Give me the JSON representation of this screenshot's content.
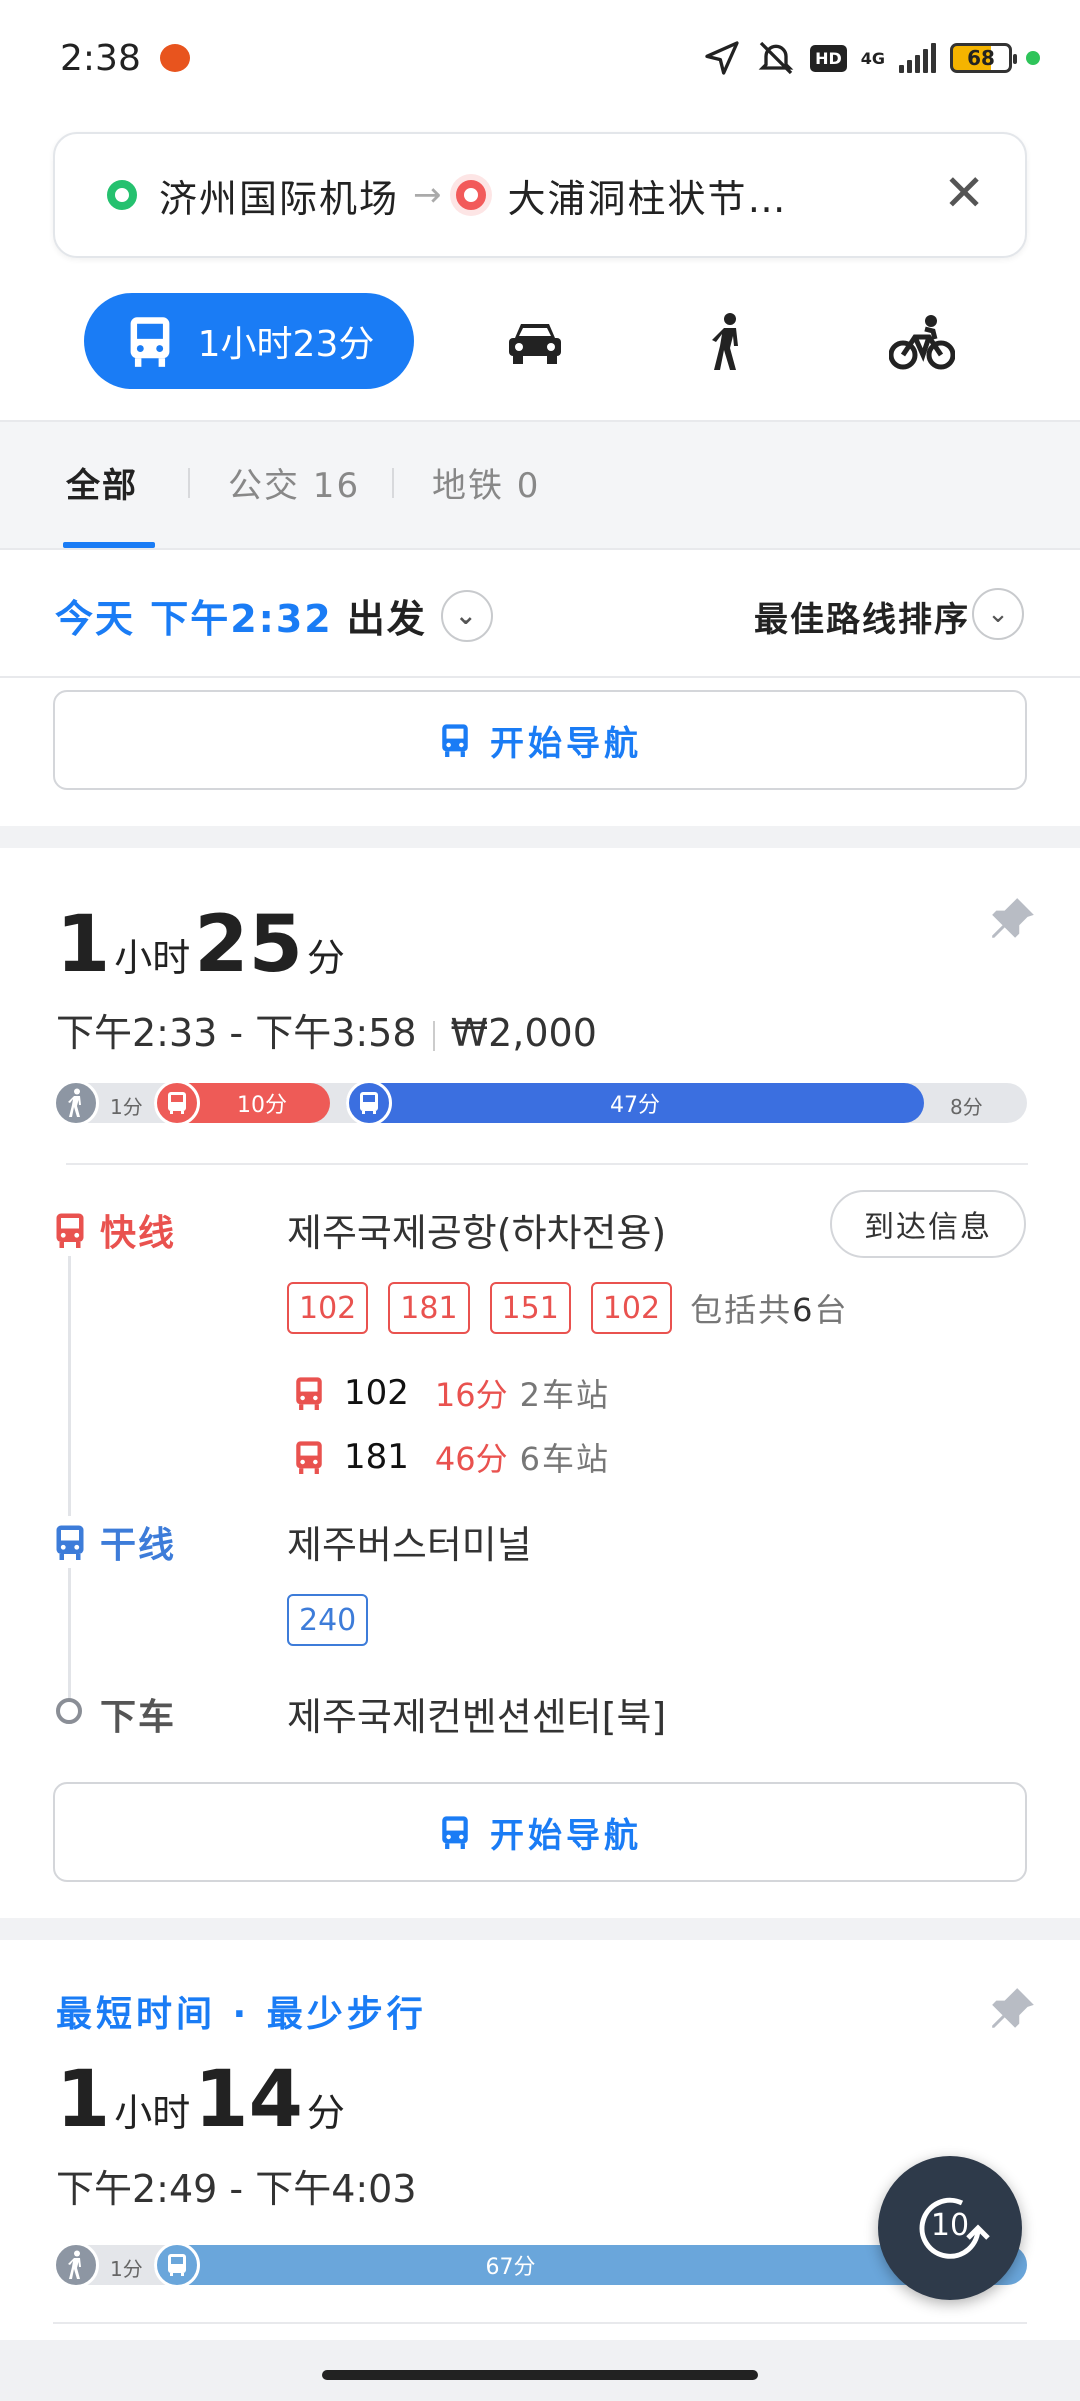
{
  "status_bar": {
    "time": "2:38",
    "network": "4G",
    "hd": "HD",
    "battery": "68"
  },
  "search": {
    "origin": "济州国际机场",
    "destination": "大浦洞柱状节…"
  },
  "modes": {
    "transit_duration": "1小时23分"
  },
  "filters": {
    "all": "全部",
    "bus": "公交 16",
    "subway": "地铁 0"
  },
  "depart": {
    "day_time": "今天 下午2:32",
    "suffix": "出发",
    "sort_label": "最佳路线排序"
  },
  "nav_label": "开始导航",
  "route1": {
    "hours": "1",
    "hour_unit": "小时",
    "minutes": "25",
    "minute_unit": "分",
    "time_range": "下午2:33 - 下午3:58",
    "fare": "₩2,000",
    "segments": {
      "walk1": "1分",
      "bus1": "10分",
      "bus2": "47分",
      "walk2": "8分"
    },
    "leg1": {
      "type_label": "快线",
      "stop": "제주국제공항(하차전용)",
      "arrival_button": "到达信息",
      "chips": [
        "102",
        "181",
        "151",
        "102"
      ],
      "total_prefix": "包括共",
      "total_count": "6",
      "total_suffix": "台",
      "arrivals": [
        {
          "route": "102",
          "minutes": "16分",
          "stops": "2车站"
        },
        {
          "route": "181",
          "minutes": "46分",
          "stops": "6车站"
        }
      ]
    },
    "leg2": {
      "type_label": "干线",
      "stop": "제주버스터미널",
      "chips": [
        "240"
      ]
    },
    "leg3": {
      "type_label": "下车",
      "stop": "제주국제컨벤션센터[북]"
    }
  },
  "route2": {
    "tags": "最短时间 · 最少步行",
    "hours": "1",
    "hour_unit": "小时",
    "minutes": "14",
    "minute_unit": "分",
    "time_range": "下午2:49 - 下午4:03",
    "segments": {
      "walk1": "1分",
      "bus1": "67分"
    }
  },
  "fab_label": "10",
  "colors": {
    "primary_blue": "#1a7cf5",
    "express_red": "#e9524f",
    "trunk_blue": "#3d7cd9",
    "bus_blue_bar": "#3b6fe0",
    "light_blue_bar": "#6aa6db"
  }
}
